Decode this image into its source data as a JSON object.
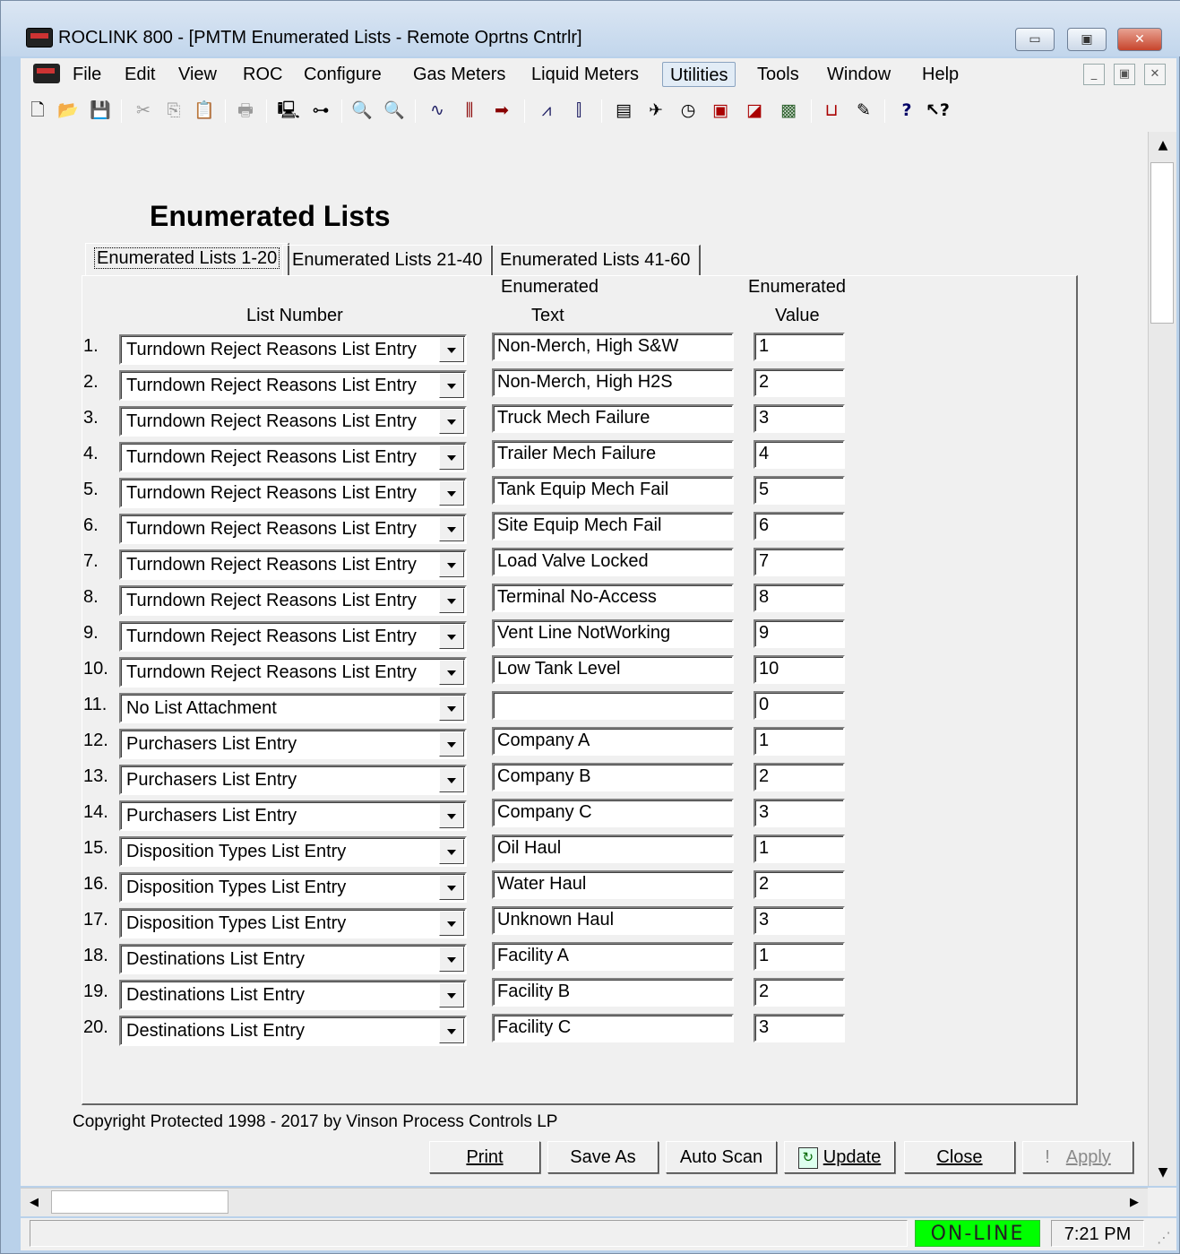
{
  "window": {
    "title": "ROCLINK 800 - [PMTM Enumerated Lists - Remote Oprtns Cntrlr]",
    "minimize_label": "▭",
    "maximize_label": "▣",
    "close_label": "✕"
  },
  "menu": [
    "File",
    "Edit",
    "View",
    "ROC",
    "Configure",
    "Gas Meters",
    "Liquid Meters",
    "Utilities",
    "Tools",
    "Window",
    "Help"
  ],
  "menu_active": "Utilities",
  "mdi_buttons": [
    "_",
    "▣",
    "✕"
  ],
  "toolbar_icons": [
    "new-icon",
    "open-icon",
    "save-icon",
    "cut-icon",
    "copy-icon",
    "paste-icon",
    "print-icon",
    "connect-icon",
    "directory-icon",
    "zoom-in-icon",
    "zoom-out-icon",
    "wave-icon",
    "signal-icon",
    "arrow-icon",
    "trend-icon",
    "pid-icon",
    "display-icon",
    "wrench-icon",
    "clock-icon",
    "device-icon",
    "config-icon",
    "export-icon",
    "chart-icon",
    "notes-icon",
    "help-icon",
    "context-help-icon"
  ],
  "heading": "Enumerated Lists",
  "tabs": [
    "Enumerated Lists 1-20",
    "Enumerated Lists  21-40",
    "Enumerated Lists  41-60"
  ],
  "columns": {
    "list_number": "List Number",
    "text_top": "Enumerated",
    "text_bottom": "Text",
    "value_top": "Enumerated",
    "value_bottom": "Value"
  },
  "rows": [
    {
      "num": "1.",
      "list": "Turndown Reject Reasons List Entry",
      "text": "Non-Merch, High S&W",
      "value": "1"
    },
    {
      "num": "2.",
      "list": "Turndown Reject Reasons List Entry",
      "text": "Non-Merch, High H2S",
      "value": "2"
    },
    {
      "num": "3.",
      "list": "Turndown Reject Reasons List Entry",
      "text": "Truck Mech Failure",
      "value": "3"
    },
    {
      "num": "4.",
      "list": "Turndown Reject Reasons List Entry",
      "text": "Trailer Mech Failure",
      "value": "4"
    },
    {
      "num": "5.",
      "list": "Turndown Reject Reasons List Entry",
      "text": "Tank Equip Mech Fail",
      "value": "5"
    },
    {
      "num": "6.",
      "list": "Turndown Reject Reasons List Entry",
      "text": "Site Equip Mech Fail",
      "value": "6"
    },
    {
      "num": "7.",
      "list": "Turndown Reject Reasons List Entry",
      "text": "Load Valve Locked",
      "value": "7"
    },
    {
      "num": "8.",
      "list": "Turndown Reject Reasons List Entry",
      "text": "Terminal No-Access",
      "value": "8"
    },
    {
      "num": "9.",
      "list": "Turndown Reject Reasons List Entry",
      "text": "Vent Line NotWorking",
      "value": "9"
    },
    {
      "num": "10.",
      "list": "Turndown Reject Reasons List Entry",
      "text": "Low Tank Level",
      "value": "10"
    },
    {
      "num": "11.",
      "list": "No List Attachment",
      "text": "",
      "value": "0"
    },
    {
      "num": "12.",
      "list": "Purchasers List Entry",
      "text": "Company A",
      "value": "1"
    },
    {
      "num": "13.",
      "list": "Purchasers List Entry",
      "text": "Company B",
      "value": "2"
    },
    {
      "num": "14.",
      "list": "Purchasers List Entry",
      "text": "Company C",
      "value": "3"
    },
    {
      "num": "15.",
      "list": "Disposition Types List Entry",
      "text": "Oil Haul",
      "value": "1"
    },
    {
      "num": "16.",
      "list": "Disposition Types List Entry",
      "text": "Water Haul",
      "value": "2"
    },
    {
      "num": "17.",
      "list": "Disposition Types List Entry",
      "text": "Unknown Haul",
      "value": "3"
    },
    {
      "num": "18.",
      "list": "Destinations List Entry",
      "text": "Facility A",
      "value": "1"
    },
    {
      "num": "19.",
      "list": "Destinations List Entry",
      "text": "Facility B",
      "value": "2"
    },
    {
      "num": "20.",
      "list": "Destinations List Entry",
      "text": "Facility C",
      "value": "3"
    }
  ],
  "copyright": "Copyright Protected 1998 - 2017 by Vinson Process Controls LP",
  "buttons": {
    "print": "Print",
    "save_as": "Save As",
    "auto_scan": "Auto Scan",
    "update": "Update",
    "close": "Close",
    "apply": "Apply"
  },
  "status": {
    "connection": "ON-LINE",
    "time": "7:21 PM"
  },
  "colors": {
    "online": "#00ff00",
    "frame": "#b9d1ea",
    "face": "#f0f0f0"
  }
}
